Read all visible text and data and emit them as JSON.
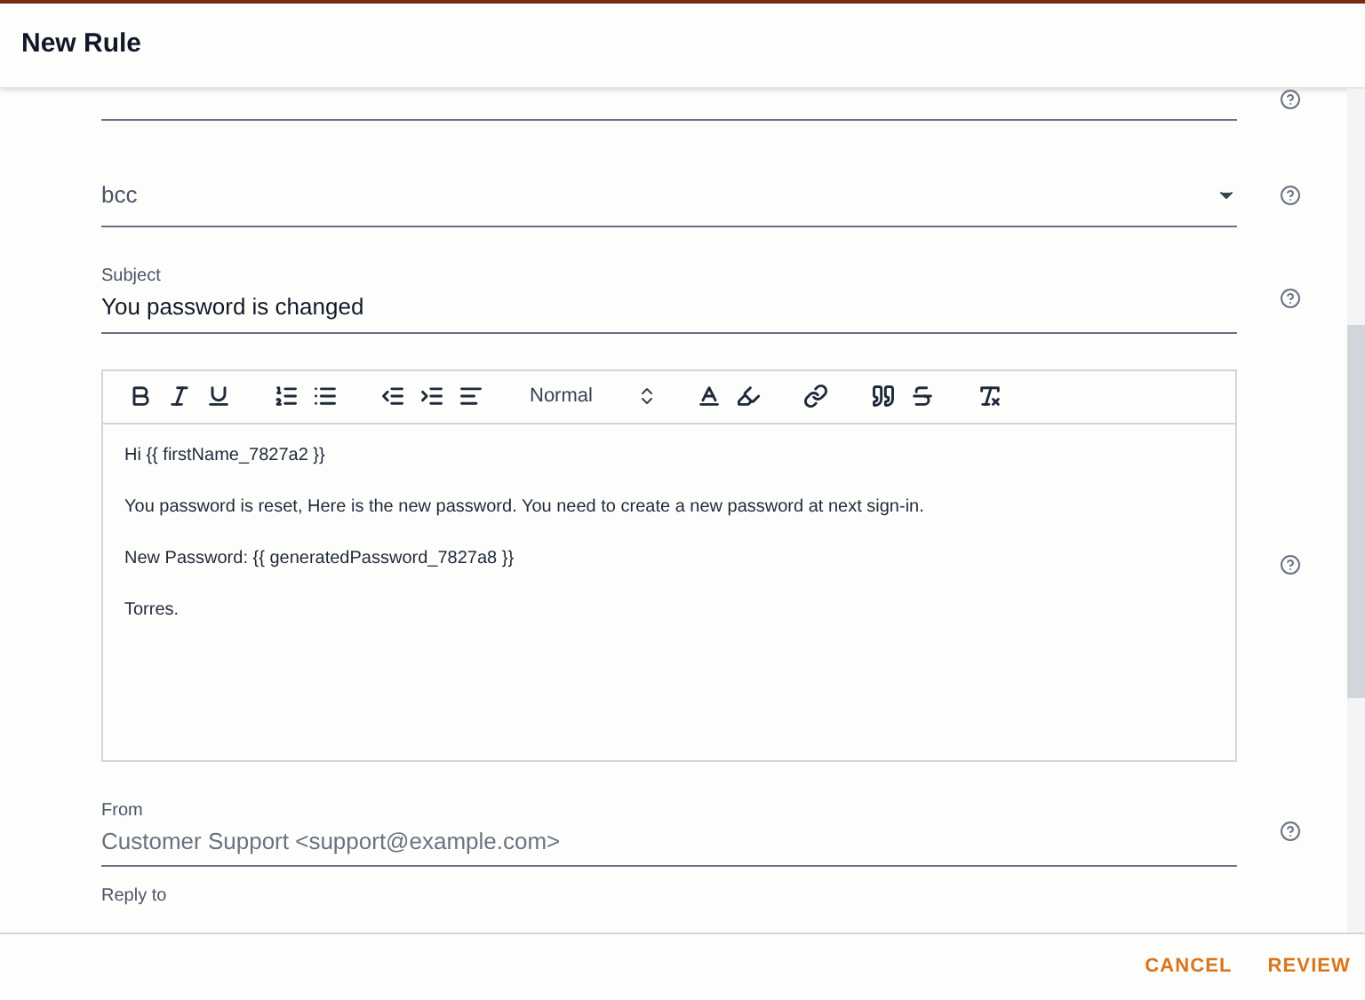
{
  "dialog": {
    "title": "New Rule"
  },
  "fields": [
    {
      "kind": "blank"
    },
    {
      "kind": "select",
      "placeholder": "bcc"
    },
    {
      "kind": "text",
      "label": "Subject",
      "value": "You password is changed"
    },
    {
      "kind": "editor",
      "style": "Normal",
      "lines": [
        "Hi {{ firstName_7827a2 }}",
        "You password is reset, Here is the new password. You need to create a new password at next sign-in.",
        "New Password: {{ generatedPassword_7827a8 }}",
        "Torres."
      ]
    },
    {
      "kind": "text",
      "label": "From",
      "placeholder": "Customer Support <support@example.com>"
    },
    {
      "kind": "partial",
      "label": "Reply to"
    }
  ],
  "buttons": [
    "CANCEL",
    "REVIEW"
  ]
}
